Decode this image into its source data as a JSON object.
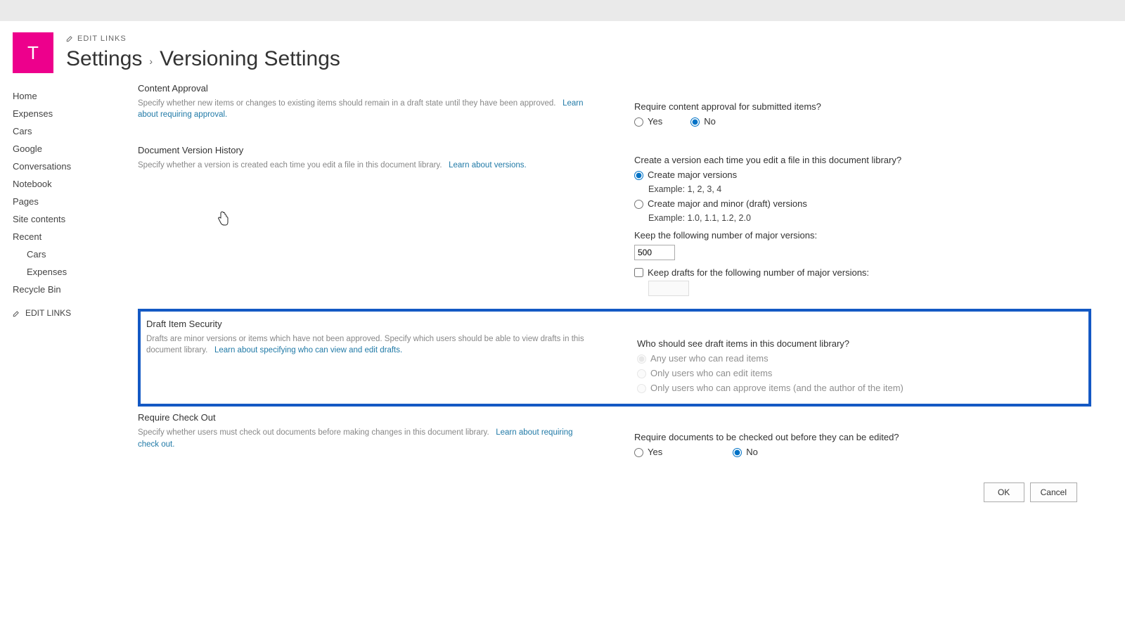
{
  "logo_letter": "T",
  "edit_links_label": "EDIT LINKS",
  "breadcrumb": {
    "parent": "Settings",
    "sep": "›",
    "current": "Versioning Settings"
  },
  "sidebar": {
    "items": [
      "Home",
      "Expenses",
      "Cars",
      "Google",
      "Conversations",
      "Notebook",
      "Pages",
      "Site contents",
      "Recent"
    ],
    "recent_sub": [
      "Cars",
      "Expenses"
    ],
    "recycle": "Recycle Bin",
    "edit_links": "EDIT LINKS"
  },
  "sections": {
    "approval": {
      "title": "Content Approval",
      "text": "Specify whether new items or changes to existing items should remain in a draft state until they have been approved.",
      "link": "Learn about requiring approval.",
      "question": "Require content approval for submitted items?",
      "yes": "Yes",
      "no": "No"
    },
    "history": {
      "title": "Document Version History",
      "text": "Specify whether a version is created each time you edit a file in this document library.",
      "link": "Learn about versions.",
      "question": "Create a version each time you edit a file in this document library?",
      "opt_major": "Create major versions",
      "ex_major": "Example: 1, 2, 3, 4",
      "opt_minor": "Create major and minor (draft) versions",
      "ex_minor": "Example: 1.0, 1.1, 1.2, 2.0",
      "keep_label": "Keep the following number of major versions:",
      "keep_value": "500",
      "keep_drafts": "Keep drafts for the following number of major versions:"
    },
    "draft": {
      "title": "Draft Item Security",
      "text": "Drafts are minor versions or items which have not been approved. Specify which users should be able to view drafts in this document library.",
      "link": "Learn about specifying who can view and edit drafts.",
      "question": "Who should see draft items in this document library?",
      "opt1": "Any user who can read items",
      "opt2": "Only users who can edit items",
      "opt3": "Only users who can approve items (and the author of the item)"
    },
    "checkout": {
      "title": "Require Check Out",
      "text": "Specify whether users must check out documents before making changes in this document library.",
      "link": "Learn about requiring check out.",
      "question": "Require documents to be checked out before they can be edited?",
      "yes": "Yes",
      "no": "No"
    }
  },
  "buttons": {
    "ok": "OK",
    "cancel": "Cancel"
  }
}
